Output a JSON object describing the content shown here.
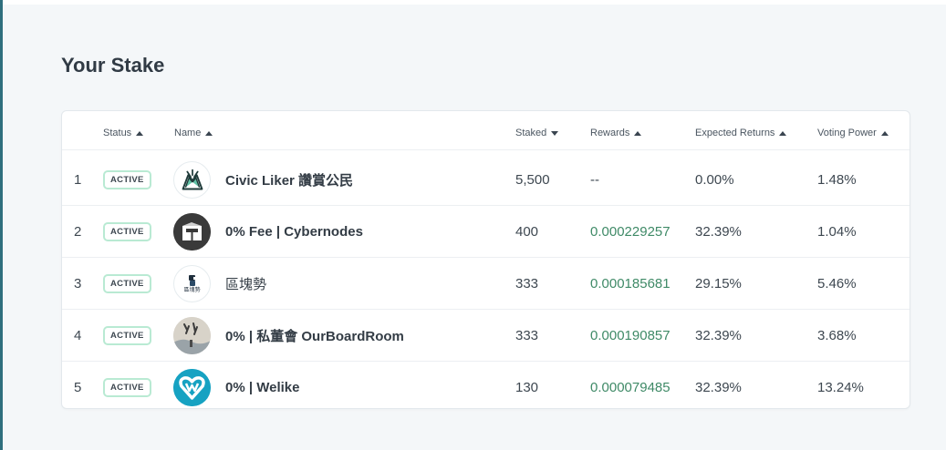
{
  "page": {
    "title": "Your Stake"
  },
  "table": {
    "columns": [
      {
        "label": "Status",
        "sort": "up"
      },
      {
        "label": "Name",
        "sort": "up"
      },
      {
        "label": "Staked",
        "sort": "down"
      },
      {
        "label": "Rewards",
        "sort": "up"
      },
      {
        "label": "Expected Returns",
        "sort": "up"
      },
      {
        "label": "Voting Power",
        "sort": "up"
      }
    ],
    "rows": [
      {
        "index": "1",
        "status": "ACTIVE",
        "name": "Civic Liker 讚賞公民",
        "name_bold": true,
        "avatar": "handshake-icon",
        "staked": "5,500",
        "rewards": "--",
        "expected_returns": "0.00%",
        "voting_power": "1.48%"
      },
      {
        "index": "2",
        "status": "ACTIVE",
        "name": "0% Fee | Cybernodes",
        "name_bold": true,
        "avatar": "cube-icon",
        "staked": "400",
        "rewards": "0.000229257",
        "expected_returns": "32.39%",
        "voting_power": "1.04%"
      },
      {
        "index": "3",
        "status": "ACTIVE",
        "name": "區塊勢",
        "name_bold": false,
        "avatar": "blocktrend-logo",
        "avatar_text": "區塊勢",
        "staked": "333",
        "rewards": "0.000185681",
        "expected_returns": "29.15%",
        "voting_power": "5.46%"
      },
      {
        "index": "4",
        "status": "ACTIVE",
        "name": "0% | 私董會 OurBoardRoom",
        "name_bold": true,
        "avatar": "calligraphy-landscape-icon",
        "staked": "333",
        "rewards": "0.000190857",
        "expected_returns": "32.39%",
        "voting_power": "3.68%"
      },
      {
        "index": "5",
        "status": "ACTIVE",
        "name": "0% | Welike",
        "name_bold": true,
        "avatar": "heart-w-icon",
        "staked": "130",
        "rewards": "0.000079485",
        "expected_returns": "32.39%",
        "voting_power": "13.24%"
      }
    ]
  },
  "colors": {
    "background": "#f4f7f9",
    "reward_green": "#3f8a67",
    "badge_border": "#b9ead3",
    "accent_teal": "#2f6f7e"
  }
}
